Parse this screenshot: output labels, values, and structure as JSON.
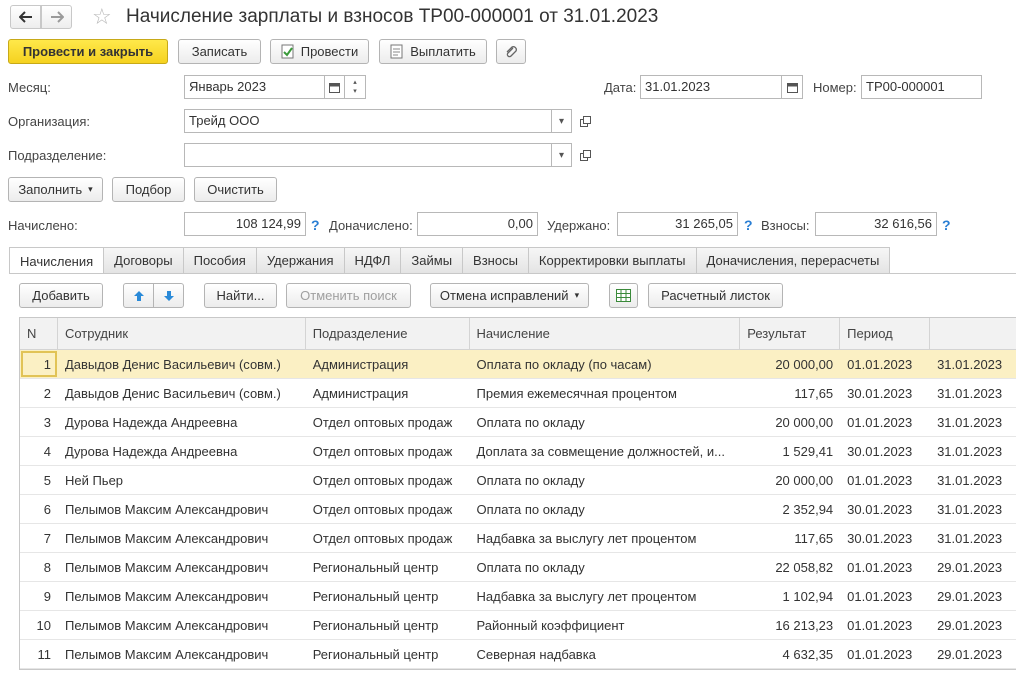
{
  "window": {
    "title": "Начисление зарплаты и взносов ТР00-000001 от 31.01.2023"
  },
  "toolbar": {
    "post_and_close": "Провести и закрыть",
    "save": "Записать",
    "post": "Провести",
    "pay": "Выплатить"
  },
  "form": {
    "month_label": "Месяц:",
    "month_value": "Январь 2023",
    "date_label": "Дата:",
    "date_value": "31.01.2023",
    "number_label": "Номер:",
    "number_value": "ТР00-000001",
    "org_label": "Организация:",
    "org_value": "Трейд ООО",
    "dept_label": "Подразделение:",
    "dept_value": ""
  },
  "actions": {
    "fill": "Заполнить",
    "select": "Подбор",
    "clear": "Очистить"
  },
  "totals": {
    "accrued_label": "Начислено:",
    "accrued_value": "108 124,99",
    "additional_label": "Доначислено:",
    "additional_value": "0,00",
    "withheld_label": "Удержано:",
    "withheld_value": "31 265,05",
    "contributions_label": "Взносы:",
    "contributions_value": "32 616,56",
    "help_mark": "?"
  },
  "tabs": [
    "Начисления",
    "Договоры",
    "Пособия",
    "Удержания",
    "НДФЛ",
    "Займы",
    "Взносы",
    "Корректировки выплаты",
    "Доначисления, перерасчеты"
  ],
  "table_toolbar": {
    "add": "Добавить",
    "find": "Найти...",
    "cancel_search": "Отменить поиск",
    "cancel_corrections": "Отмена исправлений",
    "payslip": "Расчетный листок"
  },
  "table": {
    "columns": [
      "N",
      "Сотрудник",
      "Подразделение",
      "Начисление",
      "Результат",
      "Период",
      ""
    ],
    "rows": [
      [
        "1",
        "Давыдов Денис Васильевич (совм.)",
        "Администрация",
        "Оплата по окладу (по часам)",
        "20 000,00",
        "01.01.2023",
        "31.01.2023"
      ],
      [
        "2",
        "Давыдов Денис Васильевич (совм.)",
        "Администрация",
        "Премия ежемесячная процентом",
        "117,65",
        "30.01.2023",
        "31.01.2023"
      ],
      [
        "3",
        "Дурова Надежда Андреевна",
        "Отдел оптовых продаж",
        "Оплата по окладу",
        "20 000,00",
        "01.01.2023",
        "31.01.2023"
      ],
      [
        "4",
        "Дурова Надежда Андреевна",
        "Отдел оптовых продаж",
        "Доплата за совмещение должностей, и...",
        "1 529,41",
        "30.01.2023",
        "31.01.2023"
      ],
      [
        "5",
        "Ней Пьер",
        "Отдел оптовых продаж",
        "Оплата по окладу",
        "20 000,00",
        "01.01.2023",
        "31.01.2023"
      ],
      [
        "6",
        "Пелымов Максим Александрович",
        "Отдел оптовых продаж",
        "Оплата по окладу",
        "2 352,94",
        "30.01.2023",
        "31.01.2023"
      ],
      [
        "7",
        "Пелымов Максим Александрович",
        "Отдел оптовых продаж",
        "Надбавка за выслугу лет процентом",
        "117,65",
        "30.01.2023",
        "31.01.2023"
      ],
      [
        "8",
        "Пелымов Максим Александрович",
        "Региональный центр",
        "Оплата по окладу",
        "22 058,82",
        "01.01.2023",
        "29.01.2023"
      ],
      [
        "9",
        "Пелымов Максим Александрович",
        "Региональный центр",
        "Надбавка за выслугу лет процентом",
        "1 102,94",
        "01.01.2023",
        "29.01.2023"
      ],
      [
        "10",
        "Пелымов Максим Александрович",
        "Региональный центр",
        "Районный коэффициент",
        "16 213,23",
        "01.01.2023",
        "29.01.2023"
      ],
      [
        "11",
        "Пелымов Максим Александрович",
        "Региональный центр",
        "Северная надбавка",
        "4 632,35",
        "01.01.2023",
        "29.01.2023"
      ]
    ],
    "selected_row": 0
  },
  "colors": {
    "primary_button": "#f5d220",
    "selected_row": "#fbf0c4",
    "help_mark": "#2a7fd4",
    "arrow_icons": "#2a8ad8"
  }
}
